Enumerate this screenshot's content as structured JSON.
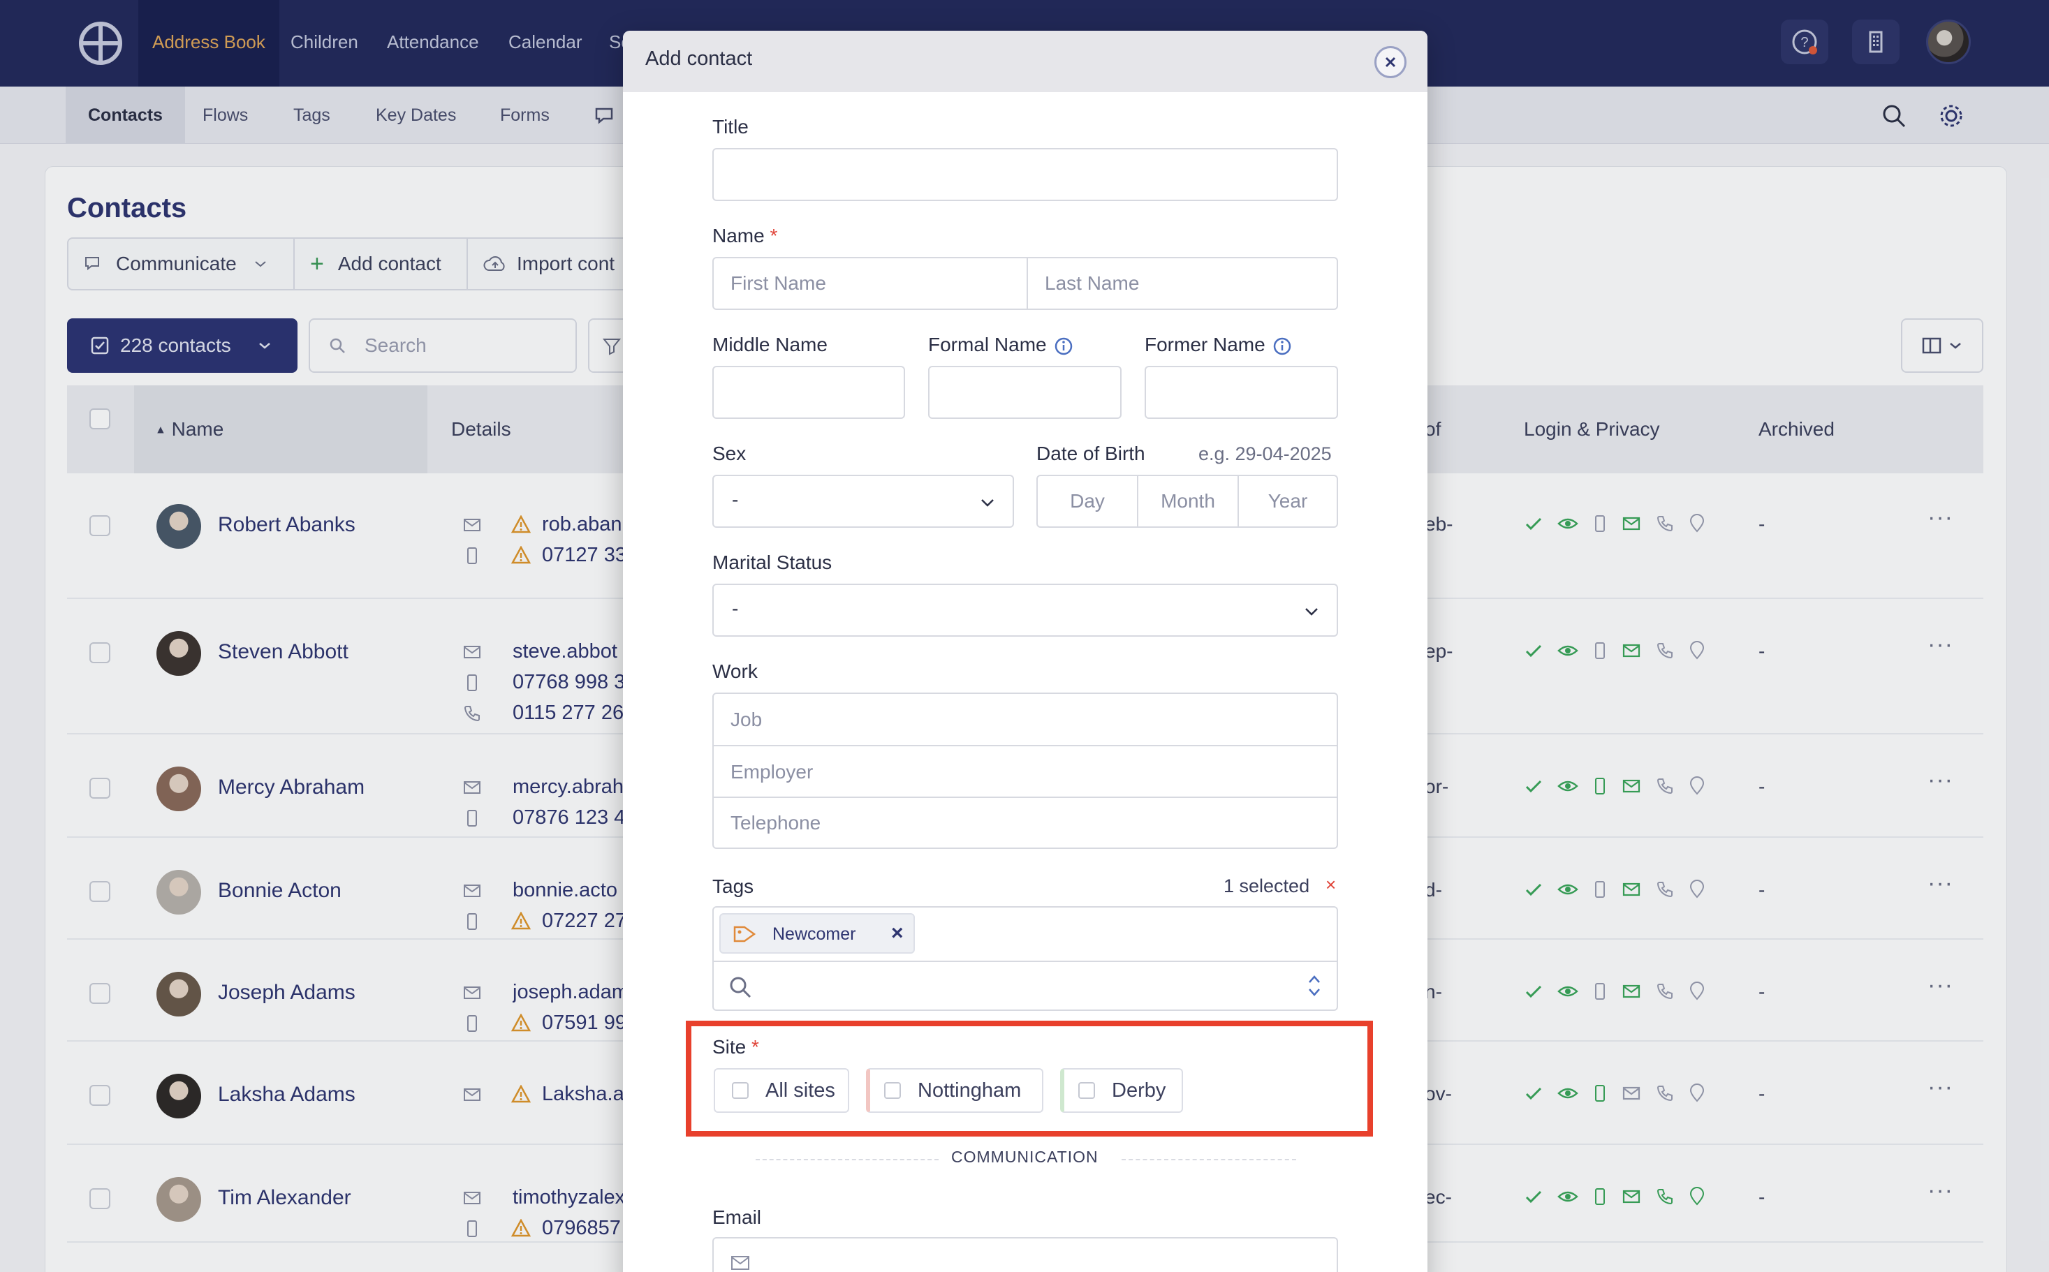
{
  "app": {
    "nav": [
      "Address Book",
      "Children",
      "Attendance",
      "Calendar",
      "Sc"
    ],
    "subnav": [
      "Contacts",
      "Flows",
      "Tags",
      "Key Dates",
      "Forms"
    ]
  },
  "contacts_page": {
    "title": "Contacts",
    "toolbar": {
      "communicate": "Communicate",
      "add_contact": "Add contact",
      "import": "Import cont"
    },
    "count_button": "228 contacts",
    "search_placeholder": "Search",
    "columns": {
      "name": "Name",
      "details": "Details",
      "of": "of",
      "login_privacy": "Login & Privacy",
      "archived": "Archived"
    },
    "rows": [
      {
        "name": "Robert Abanks",
        "line1": "rob.aban",
        "line2": "07127 33",
        "line3": "",
        "suffix": "eb-",
        "archived": "-"
      },
      {
        "name": "Steven Abbott",
        "line1": "steve.abbot",
        "line2": "07768 998 3",
        "line3": "0115 277 26",
        "suffix": "ep-",
        "archived": "-"
      },
      {
        "name": "Mercy Abraham",
        "line1": "mercy.abrah",
        "line2": "07876 123 4",
        "line3": "",
        "suffix": "or-",
        "archived": "-"
      },
      {
        "name": "Bonnie Acton",
        "line1": "bonnie.acto",
        "line2": "07227 27",
        "line3": "",
        "suffix": "d-",
        "archived": "-"
      },
      {
        "name": "Joseph Adams",
        "line1": "joseph.adam",
        "line2": "07591 99",
        "line3": "",
        "suffix": "n-",
        "archived": "-"
      },
      {
        "name": "Laksha Adams",
        "line1": "Laksha.a",
        "line2": "",
        "line3": "",
        "suffix": "ov-",
        "archived": "-"
      },
      {
        "name": "Tim Alexander",
        "line1": "timothyzalex",
        "line2": "0796857",
        "line3": "",
        "suffix": "ec-",
        "archived": "-"
      }
    ]
  },
  "modal": {
    "title": "Add contact",
    "fields": {
      "title_label": "Title",
      "name_label": "Name",
      "required_mark": "*",
      "first_name_ph": "First Name",
      "last_name_ph": "Last Name",
      "middle_name_label": "Middle Name",
      "formal_name_label": "Formal Name",
      "former_name_label": "Former Name",
      "sex_label": "Sex",
      "sex_value": "-",
      "dob_label": "Date of Birth",
      "dob_hint": "e.g. 29-04-2025",
      "day_ph": "Day",
      "month_ph": "Month",
      "year_ph": "Year",
      "marital_label": "Marital Status",
      "marital_value": "-",
      "work_label": "Work",
      "job_ph": "Job",
      "employer_ph": "Employer",
      "telephone_ph": "Telephone",
      "tags_label": "Tags",
      "tags_selected": "1 selected",
      "tags_clear": "×",
      "tag_chip": "Newcomer",
      "tag_chip_remove": "×",
      "site_label": "Site",
      "sites": [
        "All sites",
        "Nottingham",
        "Derby"
      ],
      "communication_section": "COMMUNICATION",
      "email_label": "Email"
    }
  },
  "colors": {
    "nav_bg": "#232a5c",
    "nav_active_text": "#e0a658",
    "highlight": "#e8402c",
    "required": "#e0453a",
    "nottingham_accent": "#f2c6c2",
    "derby_accent": "#cfe8cf"
  }
}
